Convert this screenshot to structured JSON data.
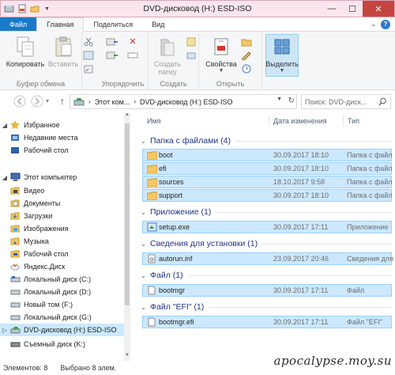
{
  "window": {
    "title": "DVD-дисковод (H:) ESD-ISO",
    "controls": {
      "minimize": "—",
      "maximize": "☐",
      "close": "✕"
    }
  },
  "ribbon_tabs": {
    "file": "Файл",
    "home": "Главная",
    "share": "Поделиться",
    "view": "Вид"
  },
  "ribbon": {
    "clipboard": {
      "copy": "Копировать",
      "paste": "Вставить",
      "label": "Буфер обмена"
    },
    "organize": {
      "label": "Упорядочить"
    },
    "create": {
      "new_folder": "Создать\nпапку",
      "label": "Создать"
    },
    "open": {
      "properties": "Свойства",
      "label": "Открыть"
    },
    "select": {
      "select": "Выделить"
    }
  },
  "address": {
    "crumbs": [
      "Этот ком...",
      "DVD-дисковод (H:) ESD-ISO"
    ],
    "search_placeholder": "Поиск: DVD-диск..."
  },
  "nav": {
    "items": [
      {
        "label": "Избранное",
        "icon": "star-icon"
      },
      {
        "label": "Недавние места",
        "icon": "recent-icon"
      },
      {
        "label": "Рабочий стол",
        "icon": "desktop-icon"
      },
      {
        "label": "Этот компьютер",
        "icon": "computer-icon"
      },
      {
        "label": "Видео",
        "icon": "video-icon"
      },
      {
        "label": "Документы",
        "icon": "documents-icon"
      },
      {
        "label": "Загрузки",
        "icon": "downloads-icon"
      },
      {
        "label": "Изображения",
        "icon": "pictures-icon"
      },
      {
        "label": "Музыка",
        "icon": "music-icon"
      },
      {
        "label": "Рабочий стол",
        "icon": "desktop-icon"
      },
      {
        "label": "Яндекс.Диск",
        "icon": "yandex-disk-icon"
      },
      {
        "label": "Локальный диск (C:)",
        "icon": "drive-icon"
      },
      {
        "label": "Локальный диск (D:)",
        "icon": "drive-icon"
      },
      {
        "label": "Новый том (F:)",
        "icon": "drive-icon"
      },
      {
        "label": "Локальный диск (G:)",
        "icon": "drive-icon"
      },
      {
        "label": "DVD-дисковод (H:) ESD-ISO",
        "icon": "dvd-icon"
      },
      {
        "label": "Съемный диск (K:)",
        "icon": "removable-drive-icon"
      }
    ]
  },
  "columns": {
    "name": "Имя",
    "date": "Дата изменения",
    "type": "Тип"
  },
  "groups": [
    {
      "title": "Папка с файлами (4)",
      "rows": [
        {
          "name": "boot",
          "date": "30.09.2017 18:10",
          "type": "Папка с файл",
          "icon": "folder-icon"
        },
        {
          "name": "efi",
          "date": "30.09.2017 18:10",
          "type": "Папка с файл",
          "icon": "folder-icon"
        },
        {
          "name": "sources",
          "date": "18.10.2017 9:58",
          "type": "Папка с файл",
          "icon": "folder-icon"
        },
        {
          "name": "support",
          "date": "30.09.2017 18:10",
          "type": "Папка с файл",
          "icon": "folder-icon"
        }
      ]
    },
    {
      "title": "Приложение (1)",
      "rows": [
        {
          "name": "setup.exe",
          "date": "30.09.2017 17:11",
          "type": "Приложение",
          "icon": "setup-icon"
        }
      ]
    },
    {
      "title": "Сведения для установки (1)",
      "rows": [
        {
          "name": "autorun.inf",
          "date": "23.09.2017 20:46",
          "type": "Сведения для",
          "icon": "inf-icon"
        }
      ]
    },
    {
      "title": "Файл (1)",
      "rows": [
        {
          "name": "bootmgr",
          "date": "30.09.2017 17:11",
          "type": "Файл",
          "icon": "file-icon"
        }
      ]
    },
    {
      "title": "Файл \"EFI\" (1)",
      "rows": [
        {
          "name": "bootmgr.efi",
          "date": "30.09.2017 17:11",
          "type": "Файл \"EFI\"",
          "icon": "file-icon"
        }
      ]
    }
  ],
  "status": {
    "count": "Элементов: 8",
    "selected": "Выбрано 8 элем."
  },
  "watermark": "apocalypse.moy.su",
  "colors": {
    "file_tab": "#1979ca",
    "selection": "#cce8ff",
    "selection_border": "#99d1ff",
    "group_title": "#1e3287",
    "close": "#c7453f"
  }
}
